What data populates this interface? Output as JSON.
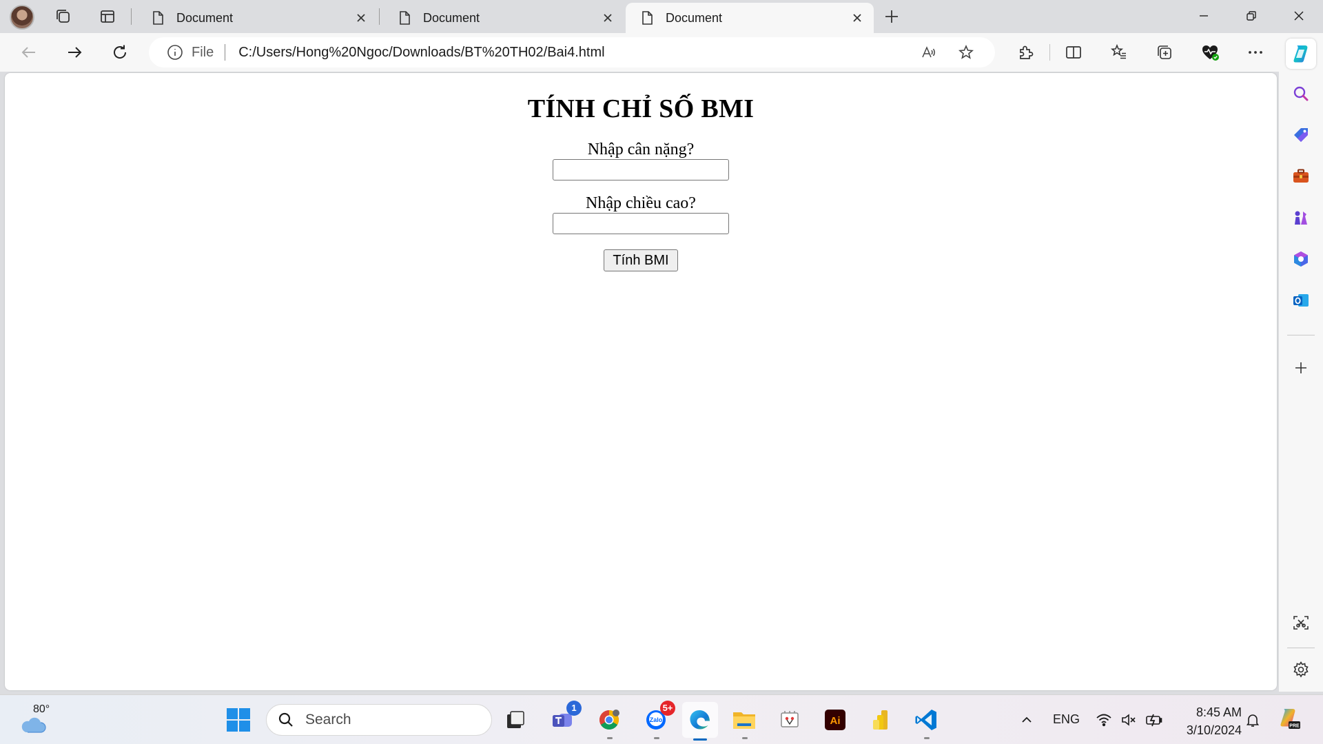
{
  "browser": {
    "tabs": [
      {
        "title": "Document",
        "active": false
      },
      {
        "title": "Document",
        "active": false
      },
      {
        "title": "Document",
        "active": true
      }
    ],
    "address": {
      "scheme_label": "File",
      "url": "C:/Users/Hong%20Ngoc/Downloads/BT%20TH02/Bai4.html"
    }
  },
  "page": {
    "heading": "TÍNH CHỈ SỐ BMI",
    "weight_label": "Nhập cân nặng?",
    "weight_value": "",
    "height_label": "Nhập chiều cao?",
    "height_value": "",
    "submit_label": "Tính BMI"
  },
  "taskbar": {
    "weather_temp": "80°",
    "search_placeholder": "Search",
    "teams_badge": "1",
    "zalo_badge": "5+",
    "language": "ENG",
    "time": "8:45 AM",
    "date": "3/10/2024"
  },
  "colors": {
    "accent": "#0067c0",
    "chrome_bg": "#dcdde0",
    "toolbar_bg": "#f7f7f7"
  }
}
